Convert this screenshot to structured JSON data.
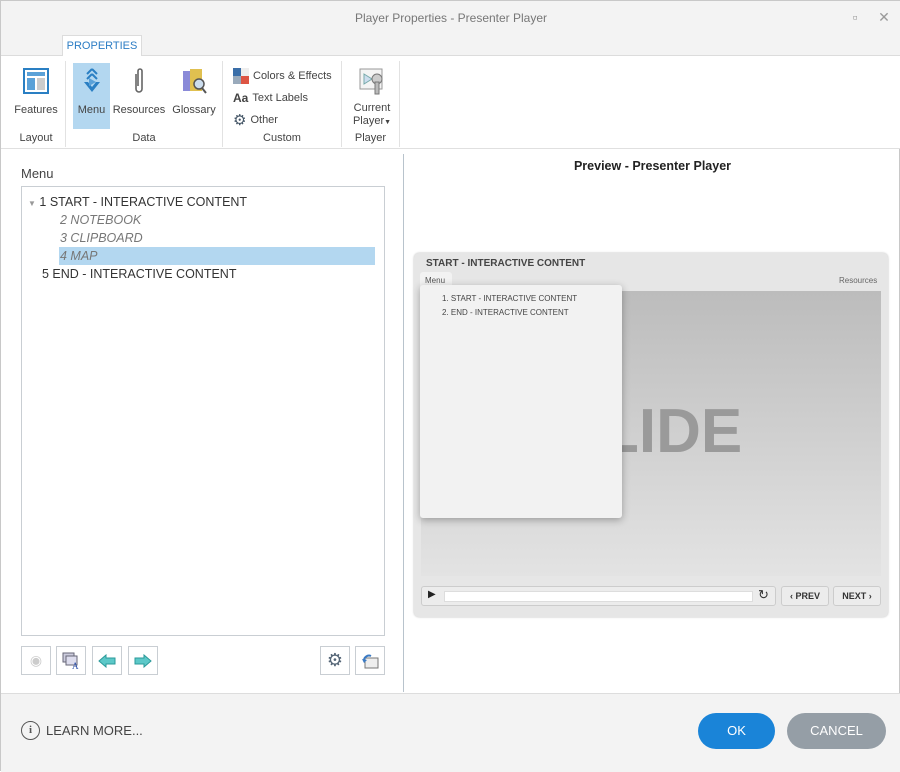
{
  "window": {
    "title": "Player Properties - Presenter Player"
  },
  "ribbon": {
    "tab": "PROPERTIES",
    "buttons": {
      "features": "Features",
      "menu": "Menu",
      "resources": "Resources",
      "glossary": "Glossary",
      "colors": "Colors & Effects",
      "text_labels": "Text Labels",
      "other": "Other",
      "current_player_1": "Current",
      "current_player_2": "Player"
    },
    "groups": {
      "layout": "Layout",
      "data": "Data",
      "custom": "Custom",
      "player": "Player"
    }
  },
  "menu_panel": {
    "label": "Menu",
    "items": [
      {
        "label": "1 START - INTERACTIVE CONTENT"
      },
      {
        "label": "2 NOTEBOOK"
      },
      {
        "label": "3 CLIPBOARD"
      },
      {
        "label": "4 MAP"
      },
      {
        "label": "5 END - INTERACTIVE CONTENT"
      }
    ]
  },
  "preview": {
    "title": "Preview - Presenter Player",
    "slide_title": "START - INTERACTIVE CONTENT",
    "menu_tab": "Menu",
    "resources_tab": "Resources",
    "menu_items": [
      "1. START - INTERACTIVE CONTENT",
      "2. END - INTERACTIVE CONTENT"
    ],
    "slide_text": "LIDE",
    "prev": "PREV",
    "next": "NEXT"
  },
  "footer": {
    "learn_more": "LEARN MORE...",
    "ok": "OK",
    "cancel": "CANCEL"
  },
  "colors": {
    "accent": "#1a84d8",
    "cancel": "#959ea6",
    "selected": "#b3d7f0"
  }
}
